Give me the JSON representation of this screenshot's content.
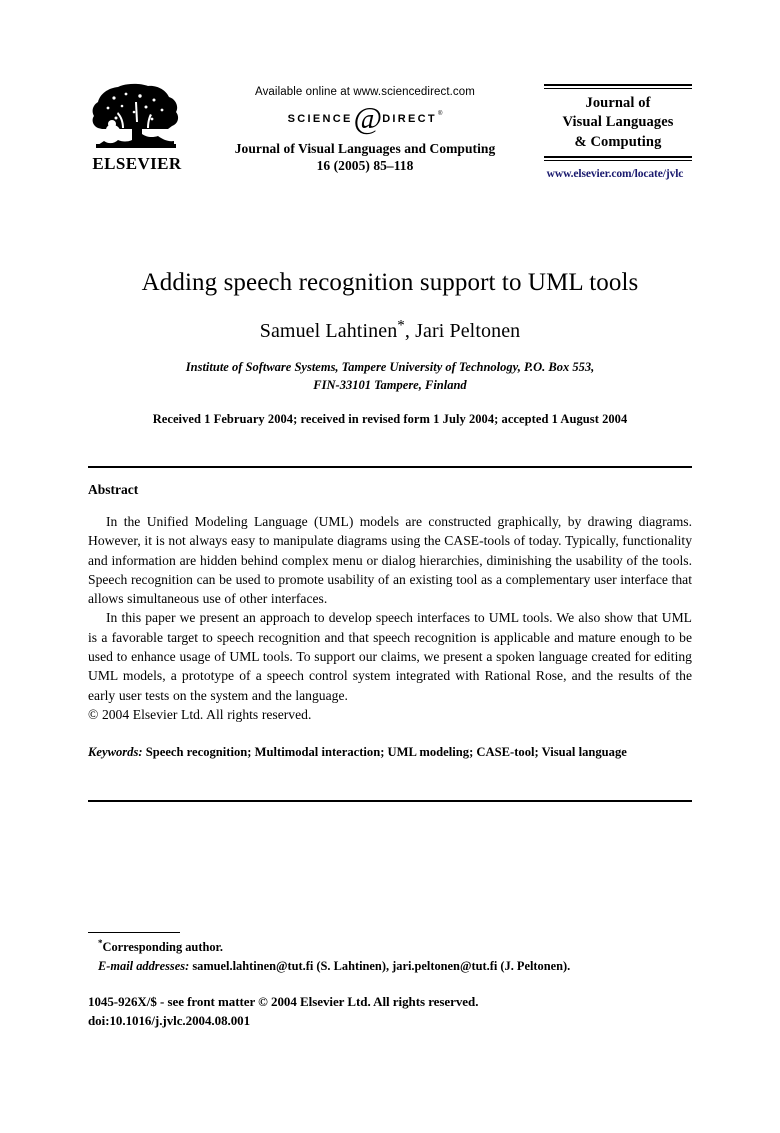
{
  "masthead": {
    "publisher_logo_word": "ELSEVIER",
    "available_online": "Available online at www.sciencedirect.com",
    "sciencedirect_science": "Science",
    "sciencedirect_at": "@",
    "sciencedirect_direct": "Direct",
    "sciencedirect_reg": "®",
    "journal_citation_line1": "Journal of Visual Languages and Computing",
    "journal_citation_line2": "16 (2005) 85–118",
    "journal_box_line1": "Journal of",
    "journal_box_line2": "Visual Languages",
    "journal_box_line3": "& Computing",
    "journal_url": "www.elsevier.com/locate/jvlc",
    "journal_url_color": "#1a1a6e"
  },
  "article": {
    "title": "Adding speech recognition support to UML tools",
    "authors": "Samuel Lahtinen",
    "author_marker": "*",
    "authors_rest": ", Jari Peltonen",
    "affiliation_line1": "Institute of Software Systems, Tampere University of Technology, P.O. Box 553,",
    "affiliation_line2": "FIN-33101 Tampere, Finland",
    "received": "Received 1 February 2004; received in revised form 1 July 2004; accepted 1 August 2004"
  },
  "abstract": {
    "heading": "Abstract",
    "paragraph1": "In the Unified Modeling Language (UML) models are constructed graphically, by drawing diagrams. However, it is not always easy to manipulate diagrams using the CASE-tools of today. Typically, functionality and information are hidden behind complex menu or dialog hierarchies, diminishing the usability of the tools. Speech recognition can be used to promote usability of an existing tool as a complementary user interface that allows simultaneous use of other interfaces.",
    "paragraph2": "In this paper we present an approach to develop speech interfaces to UML tools. We also show that UML is a favorable target to speech recognition and that speech recognition is applicable and mature enough to be used to enhance usage of UML tools. To support our claims, we present a spoken language created for editing UML models, a prototype of a speech control system integrated with Rational Rose, and the results of the early user tests on the system and the language.",
    "copyright": "© 2004 Elsevier Ltd. All rights reserved.",
    "keywords_label": "Keywords:",
    "keywords_list": "Speech recognition; Multimodal interaction; UML modeling; CASE-tool; Visual language"
  },
  "footer": {
    "corresponding_marker": "*",
    "corresponding_author": "Corresponding author.",
    "email_label": "E-mail addresses:",
    "email_text": "samuel.lahtinen@tut.fi (S. Lahtinen), jari.peltonen@tut.fi (J. Peltonen).",
    "issn_line": "1045-926X/$ - see front matter © 2004 Elsevier Ltd. All rights reserved.",
    "doi_line": "doi:10.1016/j.jvlc.2004.08.001"
  }
}
